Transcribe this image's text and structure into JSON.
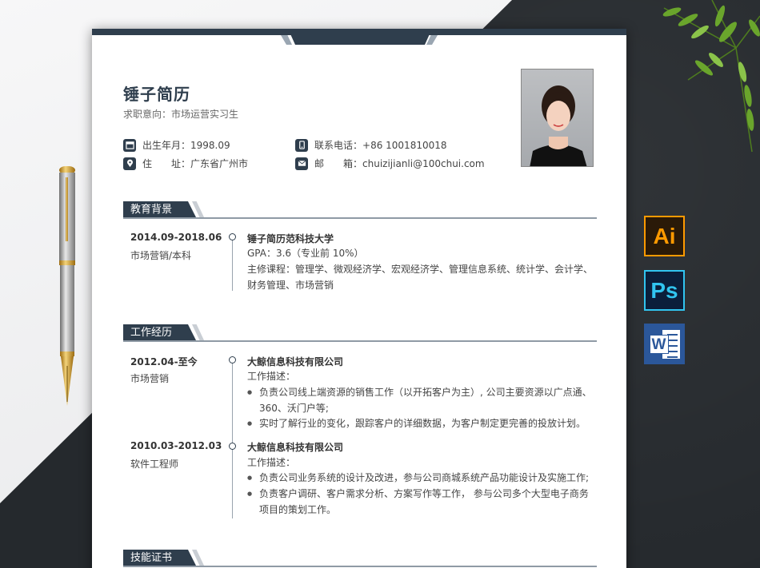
{
  "resume": {
    "name": "锤子简历",
    "intent": "求职意向：市场运营实习生",
    "info": {
      "birth_label": "出生年月：",
      "birth_value": "1998.09",
      "phone_label": "联系电话：",
      "phone_value": "+86 1001810018",
      "addr_label": "住　　址：",
      "addr_value": "广东省广州市",
      "mail_label": "邮　　箱：",
      "mail_value": "chuizijianli@100chui.com"
    },
    "education": {
      "title": "教育背景",
      "date": "2014.09-2018.06",
      "major": "市场营销/本科",
      "school": "锤子简历范科技大学",
      "gpa": "GPA：3.6（专业前 10%）",
      "courses": "主修课程：管理学、微观经济学、宏观经济学、管理信息系统、统计学、会计学、财务管理、市场营销"
    },
    "work": {
      "title": "工作经历",
      "jobs": [
        {
          "date": "2012.04-至今",
          "role": "市场营销",
          "company": "大鲸信息科技有限公司",
          "desc_label": "工作描述：",
          "bullets": [
            "负责公司线上端资源的销售工作（以开拓客户为主）, 公司主要资源以广点通、360、沃门户等;",
            "实时了解行业的变化，跟踪客户的详细数据，为客户制定更完善的投放计划。"
          ]
        },
        {
          "date": "2010.03-2012.03",
          "role": "软件工程师",
          "company": "大鲸信息科技有限公司",
          "desc_label": "工作描述：",
          "bullets": [
            "负责公司业务系统的设计及改进，参与公司商城系统产品功能设计及实施工作;",
            "负责客户调研、客户需求分析、方案写作等工作， 参与公司多个大型电子商务项目的策划工作。"
          ]
        }
      ]
    },
    "skills": {
      "title": "技能证书"
    }
  },
  "software": {
    "ai": "Ai",
    "ps": "Ps",
    "word": "W"
  },
  "colors": {
    "accent": "#2f3e4d",
    "background_dark": "#25292d"
  }
}
